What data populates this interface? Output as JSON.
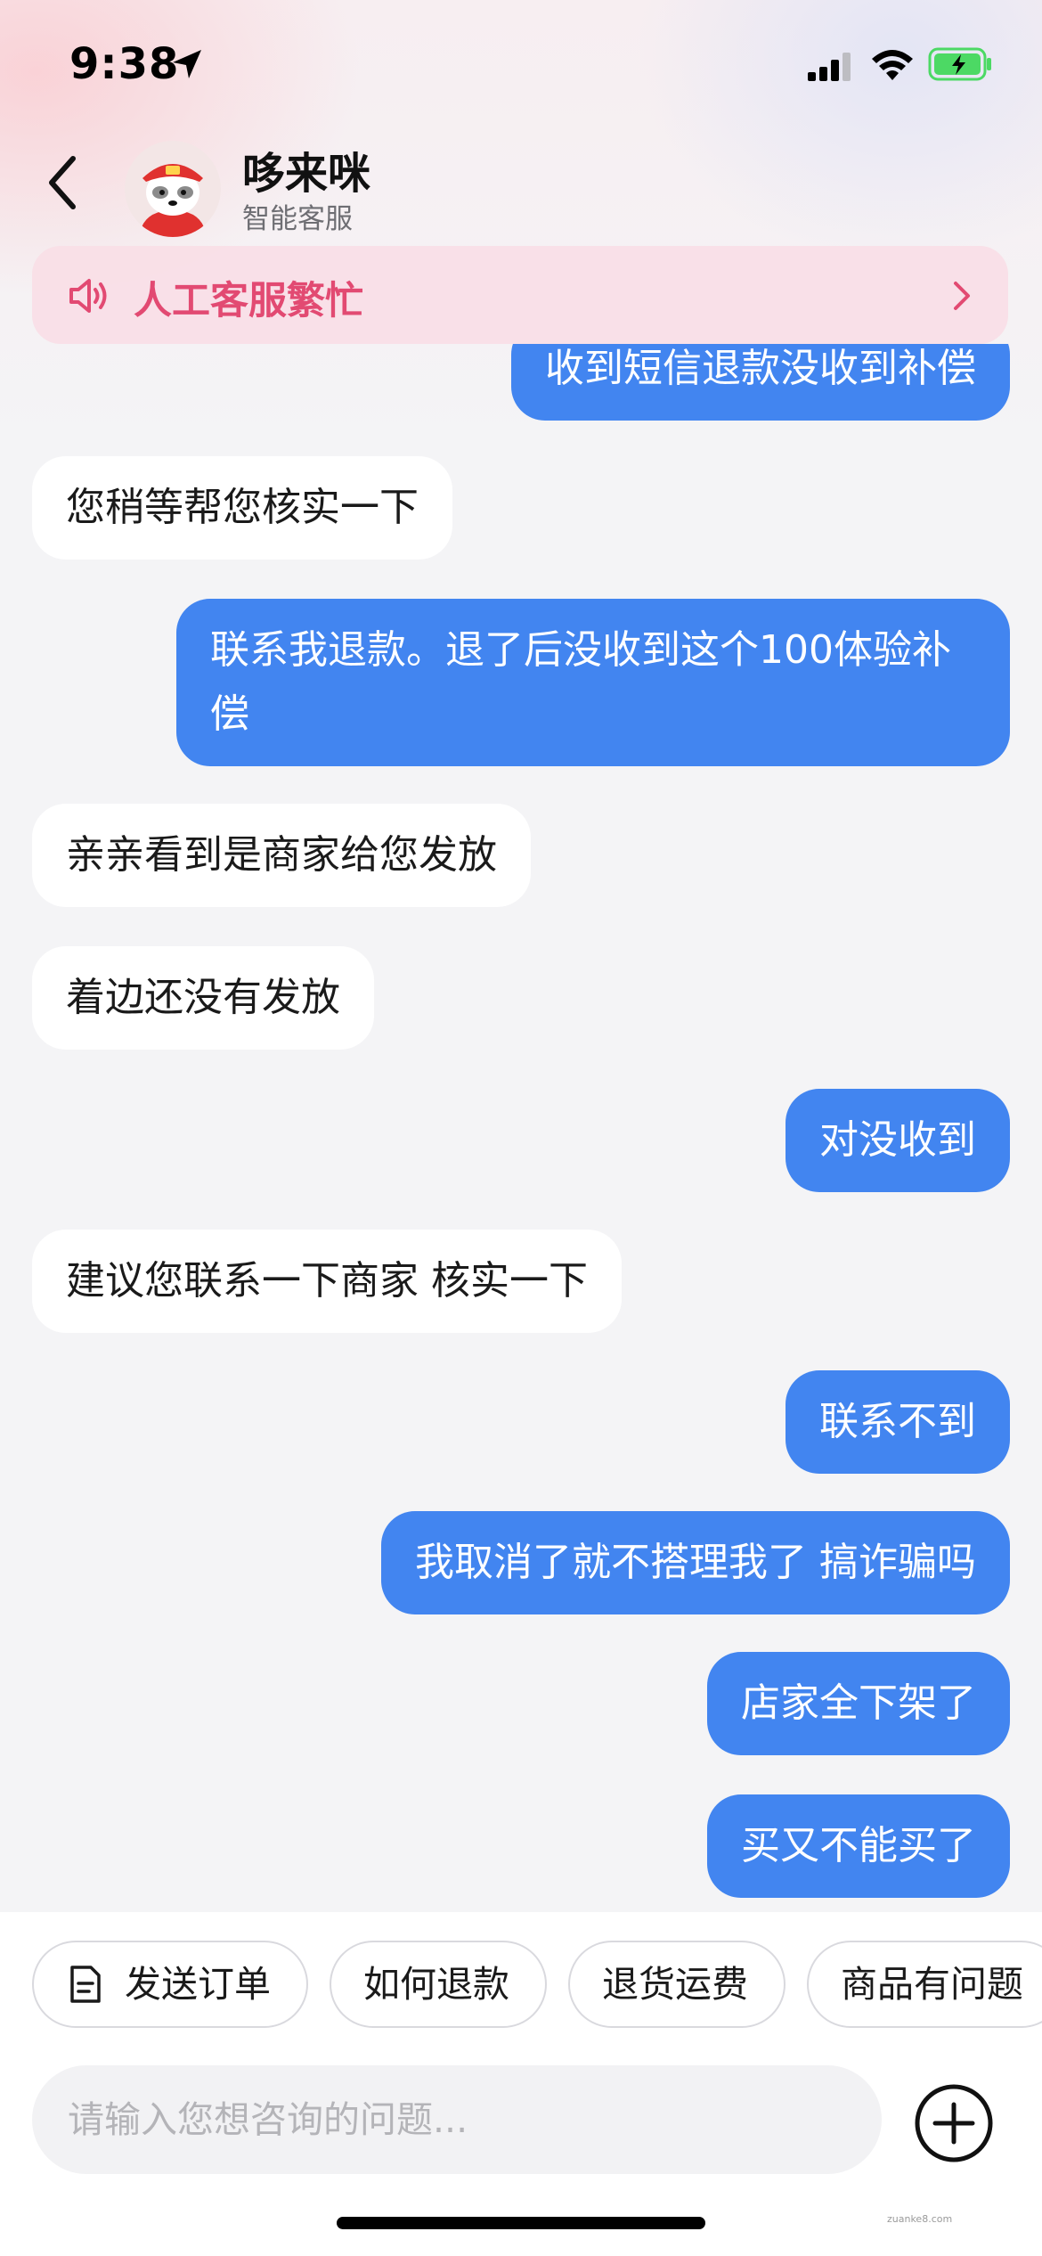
{
  "status_bar": {
    "time": "9:38"
  },
  "header": {
    "title": "哆来咪",
    "subtitle": "智能客服"
  },
  "notice": {
    "text": "人工客服繁忙"
  },
  "messages": [
    {
      "side": "right",
      "text": "收到短信退款没收到补偿"
    },
    {
      "side": "left",
      "text": "您稍等帮您核实一下"
    },
    {
      "side": "right",
      "text": "联系我退款。退了后没收到这个100体验补偿"
    },
    {
      "side": "left",
      "text": "亲亲看到是商家给您发放"
    },
    {
      "side": "left",
      "text": "着边还没有发放"
    },
    {
      "side": "right",
      "text": "对没收到"
    },
    {
      "side": "left",
      "text": "建议您联系一下商家 核实一下"
    },
    {
      "side": "right",
      "text": "联系不到"
    },
    {
      "side": "right",
      "text": "我取消了就不搭理我了 搞诈骗吗"
    },
    {
      "side": "right",
      "text": "店家全下架了"
    },
    {
      "side": "right",
      "text": "买又不能买了"
    }
  ],
  "quick_actions": [
    {
      "label": "发送订单",
      "icon": "document-icon"
    },
    {
      "label": "如何退款"
    },
    {
      "label": "退货运费"
    },
    {
      "label": "商品有问题"
    }
  ],
  "input": {
    "placeholder": "请输入您想咨询的问题..."
  },
  "icons": {
    "back": "chevron-left-icon",
    "speaker": "speaker-icon",
    "notice_arrow": "chevron-right-icon",
    "plus": "plus-circle-icon"
  },
  "colors": {
    "user_bubble": "#4285f0",
    "bot_bubble": "#ffffff",
    "notice_text": "#e24a72",
    "notice_bg": "#f8dee6",
    "battery": "#4cd964"
  },
  "watermark": "zuanke8.com"
}
